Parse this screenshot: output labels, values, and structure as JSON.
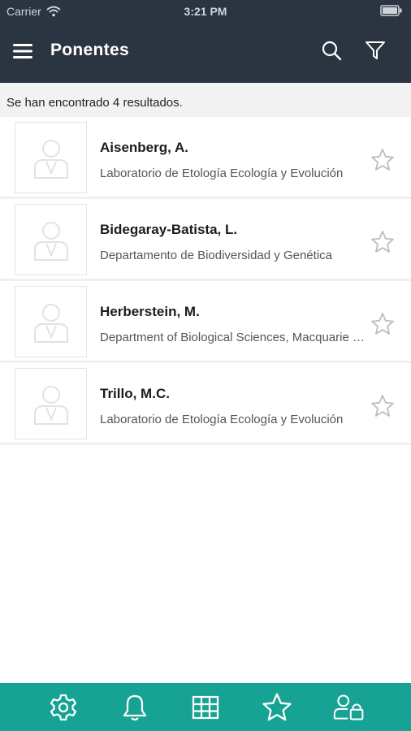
{
  "status_bar": {
    "carrier": "Carrier",
    "time": "3:21 PM"
  },
  "header": {
    "title": "Ponentes",
    "icons": [
      "menu-icon",
      "search-icon",
      "filter-icon"
    ]
  },
  "results": {
    "text": "Se han encontrado 4 resultados."
  },
  "speakers": [
    {
      "name": "Aisenberg, A.",
      "affiliation": "Laboratorio de Etología Ecología y Evolución"
    },
    {
      "name": "Bidegaray-Batista, L.",
      "affiliation": "Departamento de Biodiversidad y Genética"
    },
    {
      "name": "Herberstein, M.",
      "affiliation": "Department of Biological Sciences, Macquarie University"
    },
    {
      "name": "Trillo, M.C.",
      "affiliation": "Laboratorio de Etología Ecología y Evolución"
    }
  ],
  "tab_bar": {
    "color": "#17a393",
    "icons": [
      "settings-icon",
      "bell-icon",
      "grid-icon",
      "star-icon",
      "user-lock-icon"
    ]
  },
  "colors": {
    "header_bg": "#2b3441",
    "accent": "#17a393"
  }
}
